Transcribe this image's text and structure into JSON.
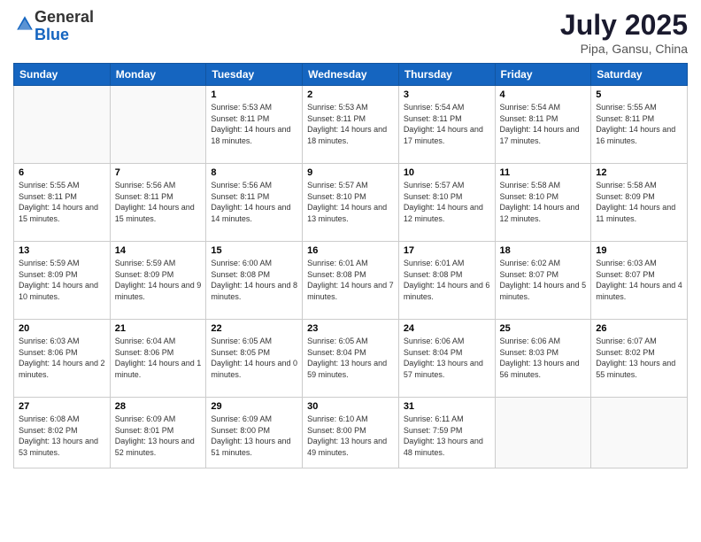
{
  "logo": {
    "general": "General",
    "blue": "Blue"
  },
  "header": {
    "month": "July 2025",
    "location": "Pipa, Gansu, China"
  },
  "weekdays": [
    "Sunday",
    "Monday",
    "Tuesday",
    "Wednesday",
    "Thursday",
    "Friday",
    "Saturday"
  ],
  "weeks": [
    [
      {
        "day": "",
        "info": ""
      },
      {
        "day": "",
        "info": ""
      },
      {
        "day": "1",
        "info": "Sunrise: 5:53 AM\nSunset: 8:11 PM\nDaylight: 14 hours and 18 minutes."
      },
      {
        "day": "2",
        "info": "Sunrise: 5:53 AM\nSunset: 8:11 PM\nDaylight: 14 hours and 18 minutes."
      },
      {
        "day": "3",
        "info": "Sunrise: 5:54 AM\nSunset: 8:11 PM\nDaylight: 14 hours and 17 minutes."
      },
      {
        "day": "4",
        "info": "Sunrise: 5:54 AM\nSunset: 8:11 PM\nDaylight: 14 hours and 17 minutes."
      },
      {
        "day": "5",
        "info": "Sunrise: 5:55 AM\nSunset: 8:11 PM\nDaylight: 14 hours and 16 minutes."
      }
    ],
    [
      {
        "day": "6",
        "info": "Sunrise: 5:55 AM\nSunset: 8:11 PM\nDaylight: 14 hours and 15 minutes."
      },
      {
        "day": "7",
        "info": "Sunrise: 5:56 AM\nSunset: 8:11 PM\nDaylight: 14 hours and 15 minutes."
      },
      {
        "day": "8",
        "info": "Sunrise: 5:56 AM\nSunset: 8:11 PM\nDaylight: 14 hours and 14 minutes."
      },
      {
        "day": "9",
        "info": "Sunrise: 5:57 AM\nSunset: 8:10 PM\nDaylight: 14 hours and 13 minutes."
      },
      {
        "day": "10",
        "info": "Sunrise: 5:57 AM\nSunset: 8:10 PM\nDaylight: 14 hours and 12 minutes."
      },
      {
        "day": "11",
        "info": "Sunrise: 5:58 AM\nSunset: 8:10 PM\nDaylight: 14 hours and 12 minutes."
      },
      {
        "day": "12",
        "info": "Sunrise: 5:58 AM\nSunset: 8:09 PM\nDaylight: 14 hours and 11 minutes."
      }
    ],
    [
      {
        "day": "13",
        "info": "Sunrise: 5:59 AM\nSunset: 8:09 PM\nDaylight: 14 hours and 10 minutes."
      },
      {
        "day": "14",
        "info": "Sunrise: 5:59 AM\nSunset: 8:09 PM\nDaylight: 14 hours and 9 minutes."
      },
      {
        "day": "15",
        "info": "Sunrise: 6:00 AM\nSunset: 8:08 PM\nDaylight: 14 hours and 8 minutes."
      },
      {
        "day": "16",
        "info": "Sunrise: 6:01 AM\nSunset: 8:08 PM\nDaylight: 14 hours and 7 minutes."
      },
      {
        "day": "17",
        "info": "Sunrise: 6:01 AM\nSunset: 8:08 PM\nDaylight: 14 hours and 6 minutes."
      },
      {
        "day": "18",
        "info": "Sunrise: 6:02 AM\nSunset: 8:07 PM\nDaylight: 14 hours and 5 minutes."
      },
      {
        "day": "19",
        "info": "Sunrise: 6:03 AM\nSunset: 8:07 PM\nDaylight: 14 hours and 4 minutes."
      }
    ],
    [
      {
        "day": "20",
        "info": "Sunrise: 6:03 AM\nSunset: 8:06 PM\nDaylight: 14 hours and 2 minutes."
      },
      {
        "day": "21",
        "info": "Sunrise: 6:04 AM\nSunset: 8:06 PM\nDaylight: 14 hours and 1 minute."
      },
      {
        "day": "22",
        "info": "Sunrise: 6:05 AM\nSunset: 8:05 PM\nDaylight: 14 hours and 0 minutes."
      },
      {
        "day": "23",
        "info": "Sunrise: 6:05 AM\nSunset: 8:04 PM\nDaylight: 13 hours and 59 minutes."
      },
      {
        "day": "24",
        "info": "Sunrise: 6:06 AM\nSunset: 8:04 PM\nDaylight: 13 hours and 57 minutes."
      },
      {
        "day": "25",
        "info": "Sunrise: 6:06 AM\nSunset: 8:03 PM\nDaylight: 13 hours and 56 minutes."
      },
      {
        "day": "26",
        "info": "Sunrise: 6:07 AM\nSunset: 8:02 PM\nDaylight: 13 hours and 55 minutes."
      }
    ],
    [
      {
        "day": "27",
        "info": "Sunrise: 6:08 AM\nSunset: 8:02 PM\nDaylight: 13 hours and 53 minutes."
      },
      {
        "day": "28",
        "info": "Sunrise: 6:09 AM\nSunset: 8:01 PM\nDaylight: 13 hours and 52 minutes."
      },
      {
        "day": "29",
        "info": "Sunrise: 6:09 AM\nSunset: 8:00 PM\nDaylight: 13 hours and 51 minutes."
      },
      {
        "day": "30",
        "info": "Sunrise: 6:10 AM\nSunset: 8:00 PM\nDaylight: 13 hours and 49 minutes."
      },
      {
        "day": "31",
        "info": "Sunrise: 6:11 AM\nSunset: 7:59 PM\nDaylight: 13 hours and 48 minutes."
      },
      {
        "day": "",
        "info": ""
      },
      {
        "day": "",
        "info": ""
      }
    ]
  ]
}
